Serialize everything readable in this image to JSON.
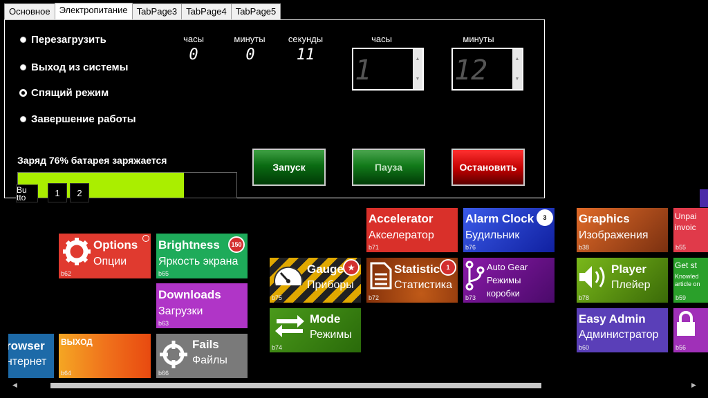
{
  "tabs": [
    "Основное",
    "Электропитание",
    "TabPage3",
    "TabPage4",
    "TabPage5"
  ],
  "active_tab": 1,
  "radios": [
    {
      "label": "Перезагрузить",
      "selected": false
    },
    {
      "label": "Выход из системы",
      "selected": false
    },
    {
      "label": "Спящий режим",
      "selected": true
    },
    {
      "label": "Завершение работы",
      "selected": false
    }
  ],
  "timer": {
    "hours_label": "часы",
    "minutes_label": "минуты",
    "seconds_label": "секунды",
    "hours": "0",
    "minutes": "0",
    "seconds": "11"
  },
  "set_time": {
    "hours_label": "часы",
    "minutes_label": "минуты",
    "hours": "1",
    "minutes": "12"
  },
  "battery": {
    "label": "Заряд 76% батарея заряжается",
    "percent": 76
  },
  "mini_buttons": [
    "Bu tto",
    "1",
    "2"
  ],
  "buttons": {
    "start": "Запуск",
    "pause": "Пауза",
    "stop": "Остановить"
  },
  "tiles": [
    {
      "title": "Options",
      "subtitle": "Опции",
      "id": "b62",
      "color": "#e03a2f"
    },
    {
      "title": "Brightness",
      "subtitle": "Яркость экрана",
      "id": "b65",
      "color": "#1eab5a",
      "badge": "150"
    },
    {
      "title": "Downloads",
      "subtitle": "Загрузки",
      "id": "b63",
      "color": "#b035c7"
    },
    {
      "title": "Fails",
      "subtitle": "Файлы",
      "id": "b66",
      "color": "#7a7a7a"
    },
    {
      "title": "ВЫХОД",
      "subtitle": "",
      "id": "b64",
      "color": "#f2711c"
    },
    {
      "title": "rowser",
      "subtitle": "нтернет",
      "id": "",
      "color": "#1d6aa8"
    },
    {
      "title": "Gauge",
      "subtitle": "Приборы",
      "id": "b75",
      "color": "#e0a800"
    },
    {
      "title": "Mode",
      "subtitle": "Режимы",
      "id": "b74",
      "color": "#3d8a18"
    },
    {
      "title": "Accelerator",
      "subtitle": "Акселератор",
      "id": "b71",
      "color": "#d9302a"
    },
    {
      "title": "Statistic",
      "subtitle": "Статистика",
      "id": "b72",
      "color": "#a04a12",
      "badge": "1"
    },
    {
      "title": "Alarm Clock",
      "subtitle": "Будильник",
      "id": "b76",
      "color": "#1e3fcc",
      "badge": "3"
    },
    {
      "title": "Auto Gear",
      "subtitle": "Режимы коробки",
      "id": "b73",
      "color": "#6a1a88"
    },
    {
      "title": "Graphics",
      "subtitle": "Изображения",
      "id": "b38",
      "color": "#c85a1a"
    },
    {
      "title": "Player",
      "subtitle": "Плейер",
      "id": "b78",
      "color": "#6aa012"
    },
    {
      "title": "Easy Admin",
      "subtitle": "Администратор",
      "id": "b60",
      "color": "#5a3fb8"
    },
    {
      "title": "Unpai invoic",
      "subtitle": "",
      "id": "b55",
      "color": "#e03a4a"
    },
    {
      "title": "Get st",
      "subtitle": "Knowled article on",
      "id": "b59",
      "color": "#2aa02a"
    },
    {
      "title": "",
      "subtitle": "",
      "id": "b56",
      "color": "#a030b8"
    }
  ]
}
